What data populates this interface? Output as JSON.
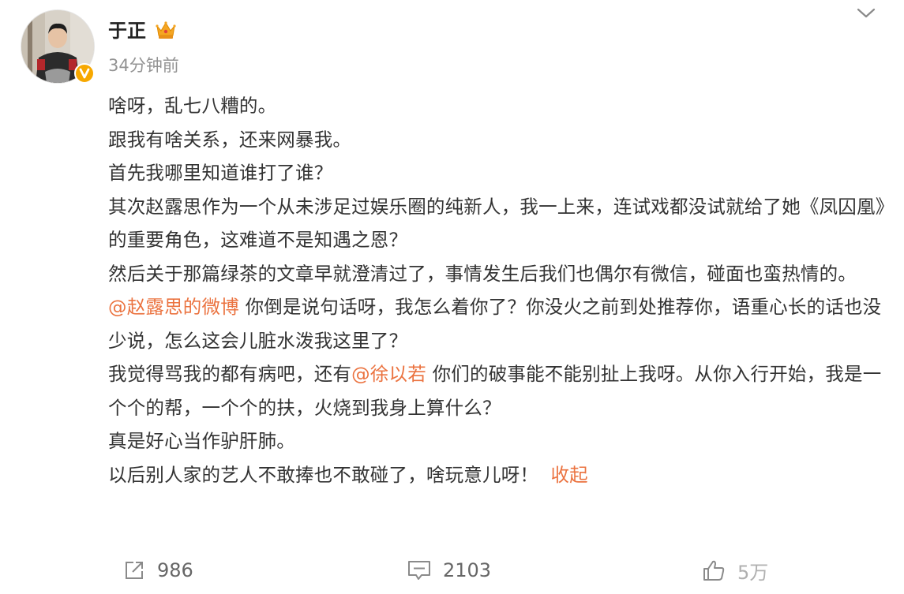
{
  "post": {
    "author": {
      "name": "于正",
      "avatar_icon": "avatar-photo",
      "verified_icon": "verified-v-badge",
      "badge_icon": "crown-icon"
    },
    "timestamp": "34分钟前",
    "menu_icon": "chevron-down-icon",
    "paragraphs": [
      "啥呀，乱七八糟的。",
      "跟我有啥关系，还来网暴我。",
      "首先我哪里知道谁打了谁？",
      "其次赵露思作为一个从未涉足过娱乐圈的纯新人，我一上来，连试戏都没试就给了她《凤囚凰》的重要角色，这难道不是知遇之恩？",
      "然后关于那篇绿茶的文章早就澄清过了，事情发生后我们也偶尔有微信，碰面也蛮热情的。"
    ],
    "mention_1": "@赵露思的微博",
    "para_after_mention_1": " 你倒是说句话呀，我怎么着你了？你没火之前到处推荐你，语重心长的话也没少说，怎么这会儿脏水泼我这里了？",
    "para_before_mention_2": "我觉得骂我的都有病吧，还有",
    "mention_2": "@徐以若",
    "para_after_mention_2": " 你们的破事能不能别扯上我呀。从你入行开始，我是一个个的帮，一个个的扶，火烧到我身上算什么？",
    "para_donkey": "真是好心当作驴肝肺。",
    "para_last": "以后别人家的艺人不敢捧也不敢碰了，啥玩意儿呀！",
    "collapse_label": "收起",
    "actions": {
      "repost_count": "986",
      "comment_count": "2103",
      "like_count": "5万",
      "repost_icon": "share-icon",
      "comment_icon": "comment-icon",
      "like_icon": "thumbs-up-icon"
    },
    "colors": {
      "link": "#eb7340",
      "text": "#333333",
      "meta": "#939393",
      "verified": "#f7a800"
    }
  }
}
